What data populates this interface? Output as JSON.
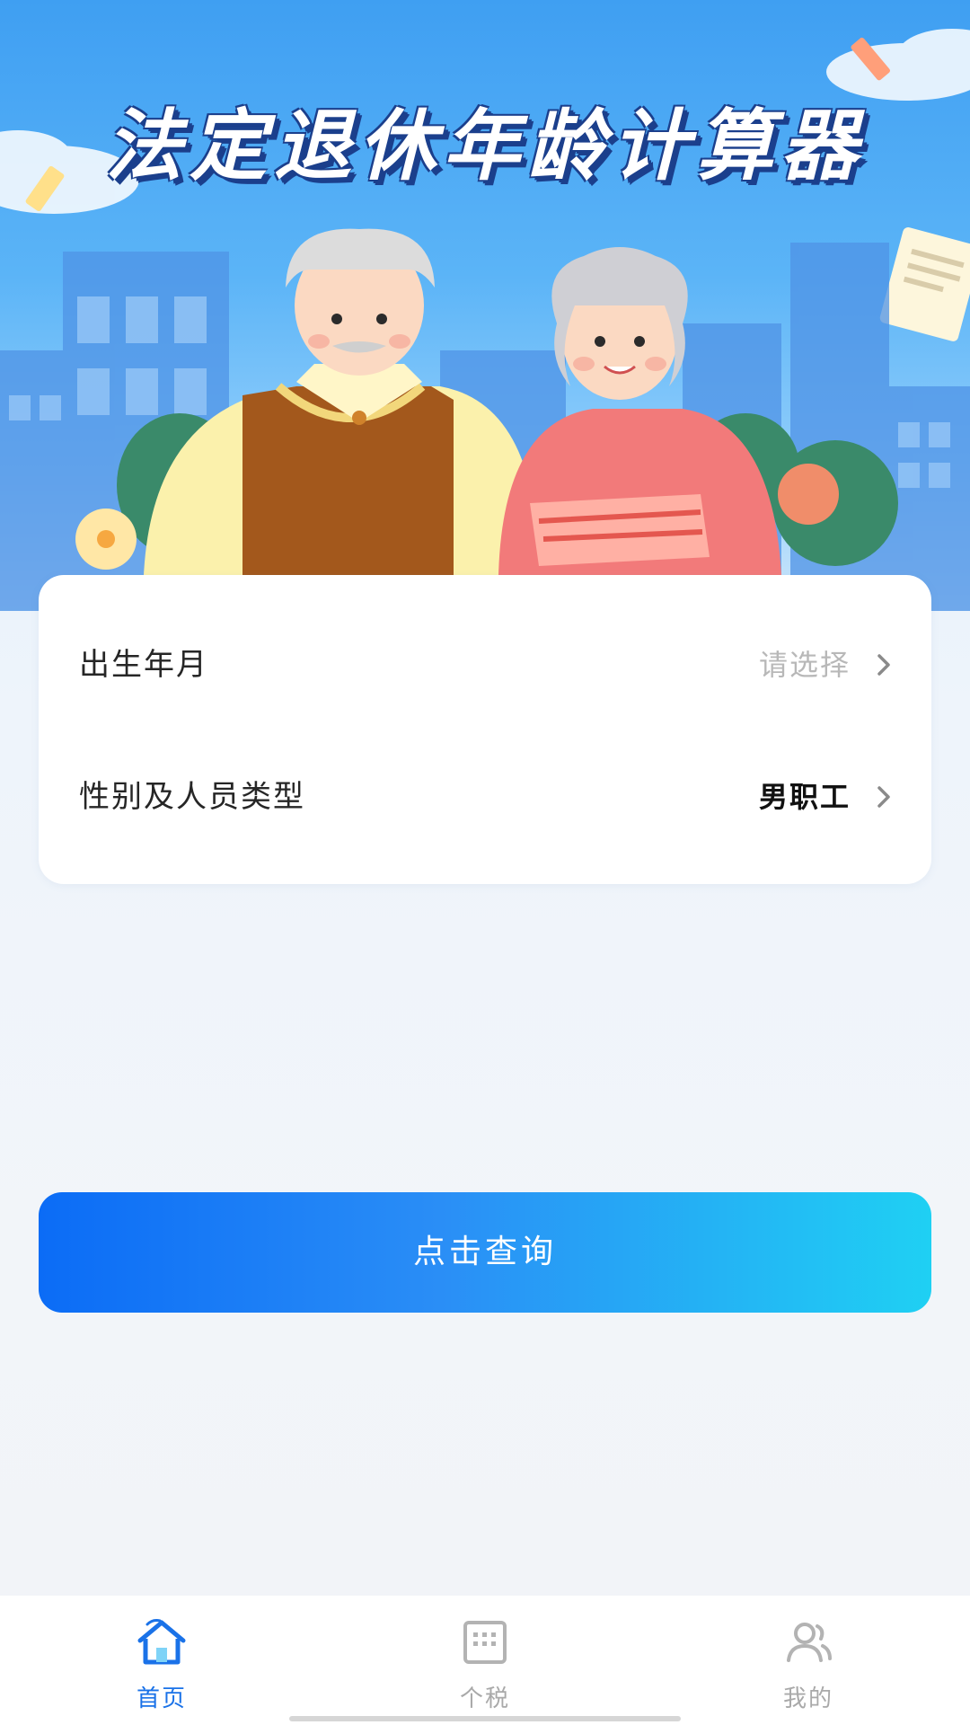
{
  "hero": {
    "title": "法定退休年龄计算器"
  },
  "form": {
    "birth": {
      "label": "出生年月",
      "value": "请选择"
    },
    "type": {
      "label": "性别及人员类型",
      "value": "男职工"
    }
  },
  "actions": {
    "query_label": "点击查询"
  },
  "tabbar": {
    "items": [
      {
        "label": "首页",
        "icon": "home-icon",
        "active": true
      },
      {
        "label": "个税",
        "icon": "tax-calculator-icon",
        "active": false
      },
      {
        "label": "我的",
        "icon": "profile-icon",
        "active": false
      }
    ]
  },
  "colors": {
    "accent": "#1a72e8",
    "button_start": "#0b6cf6",
    "button_end": "#1fd0f3",
    "placeholder": "#b8b8b8"
  }
}
